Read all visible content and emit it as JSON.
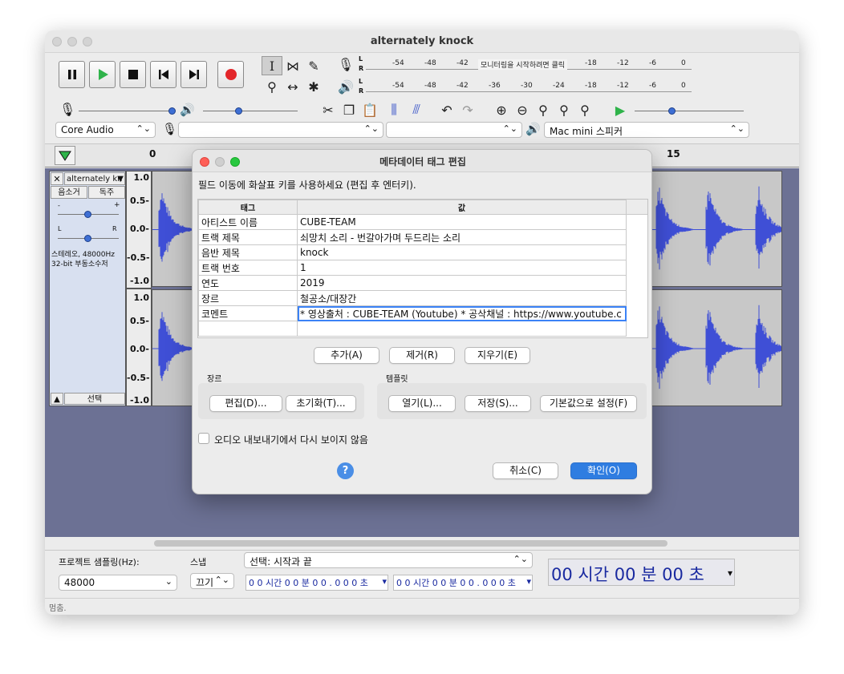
{
  "window": {
    "title": "alternately knock"
  },
  "meters": {
    "record_prompt": "모니터링을 시작하려면 클릭",
    "record_ticks": [
      "-54",
      "-48",
      "-42",
      "-18",
      "-12",
      "-6",
      "0"
    ],
    "play_ticks": [
      "-54",
      "-48",
      "-42",
      "-36",
      "-30",
      "-24",
      "-18",
      "-12",
      "-6",
      "0"
    ],
    "left_label": "L",
    "right_label": "R"
  },
  "devices": {
    "host": "Core Audio",
    "input": "",
    "channels": "",
    "output": "Mac mini 스피커"
  },
  "ruler": {
    "mark0": "0",
    "mark15": "15"
  },
  "track": {
    "name": "alternately kn",
    "mute": "음소거",
    "solo": "독주",
    "info_line1": "스테레오, 48000Hz",
    "info_line2": "32-bit 부동소수저",
    "select": "선택",
    "pan_left": "L",
    "pan_right": "R",
    "gain_minus": "-",
    "gain_plus": "+",
    "y_labels": [
      "1.0",
      "0.5-",
      "0.0-",
      "-0.5-",
      "-1.0"
    ],
    "wave_color": "#3f4fd6"
  },
  "dialog": {
    "title": "메타데이터 태그 편집",
    "instruction": "필드 이동에 화살표 키를 사용하세요 (편집 후 엔터키).",
    "col_tag": "태그",
    "col_value": "값",
    "rows": [
      {
        "tag": "아티스트 이름",
        "value": "CUBE-TEAM"
      },
      {
        "tag": "트랙 제목",
        "value": "쇠망치 소리 - 번갈아가며 두드리는 소리"
      },
      {
        "tag": "음반 제목",
        "value": "knock"
      },
      {
        "tag": "트랙 번호",
        "value": "1"
      },
      {
        "tag": "연도",
        "value": "2019"
      },
      {
        "tag": "장르",
        "value": "철공소/대장간"
      },
      {
        "tag": "코멘트",
        "value": "* 영상출처 : CUBE-TEAM (Youtube) * 공삭채널 : https://www.youtube.c"
      },
      {
        "tag": "",
        "value": ""
      }
    ],
    "add": "추가(A)",
    "remove": "제거(R)",
    "clear": "지우기(E)",
    "genre_group": "장르",
    "edit": "편집(D)...",
    "reset": "초기화(T)...",
    "template_group": "템플릿",
    "open": "열기(L)...",
    "save": "저장(S)...",
    "set_default": "기본값으로 설정(F)",
    "dont_show": "오디오 내보내기에서 다시 보이지 않음",
    "help": "?",
    "cancel": "취소(C)",
    "ok": "확인(O)"
  },
  "bottom": {
    "rate_label": "프로젝트 샘플링(Hz):",
    "rate_value": "48000",
    "snap_label": "스냅",
    "snap_value": "끄기",
    "selection_mode": "선택: 시작과 끝",
    "sel_start": "0 0 시간 0 0 분 0 0 . 0 0 0 초",
    "sel_end": "0 0 시간 0 0 분 0 0 . 0 0 0 초",
    "position": "00 시간 00 분 00 초",
    "status": "멈춤."
  }
}
